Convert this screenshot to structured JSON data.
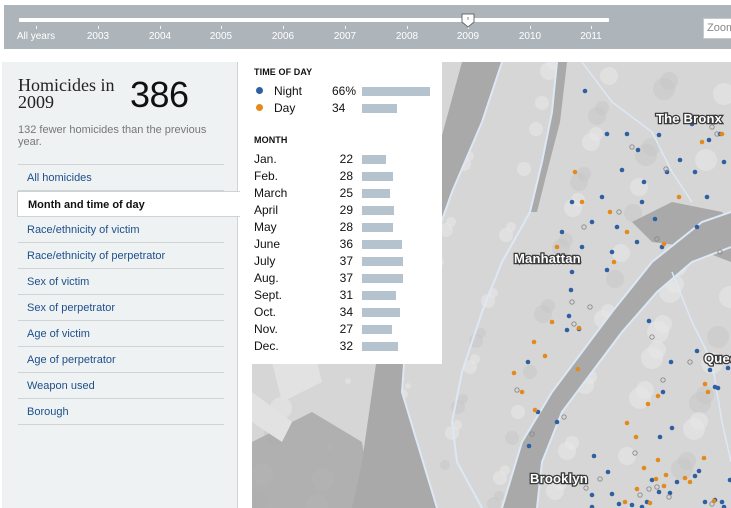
{
  "timeline": {
    "years": [
      "All years",
      "2003",
      "2004",
      "2005",
      "2006",
      "2007",
      "2008",
      "2009",
      "2010",
      "2011"
    ],
    "selected_year": "2009",
    "handle_icon": "slider-handle-icon",
    "zoom_label": "Zoom"
  },
  "sidebar": {
    "headline": "Homicides in 2009",
    "total": "386",
    "subtext": "132 fewer homicides than the previous year.",
    "nav": [
      {
        "label": "All homicides",
        "active": false
      },
      {
        "label": "Month and time of day",
        "active": true
      },
      {
        "label": "Race/ethnicity of victim",
        "active": false
      },
      {
        "label": "Race/ethnicity of perpetrator",
        "active": false
      },
      {
        "label": "Sex of victim",
        "active": false
      },
      {
        "label": "Sex of perpetrator",
        "active": false
      },
      {
        "label": "Age of victim",
        "active": false
      },
      {
        "label": "Age of perpetrator",
        "active": false
      },
      {
        "label": "Weapon used",
        "active": false
      },
      {
        "label": "Borough",
        "active": false
      }
    ]
  },
  "legend": {
    "time_of_day_title": "TIME OF DAY",
    "time_of_day": [
      {
        "label": "Night",
        "value": "66%",
        "pct": 66,
        "color": "#2e5fa3",
        "icon": "dot-icon"
      },
      {
        "label": "Day",
        "value": "34",
        "pct": 34,
        "color": "#e38a1c",
        "icon": "dot-icon"
      }
    ],
    "month_title": "MONTH",
    "months": [
      {
        "label": "Jan.",
        "value": 22
      },
      {
        "label": "Feb.",
        "value": 28
      },
      {
        "label": "March",
        "value": 25
      },
      {
        "label": "April",
        "value": 29
      },
      {
        "label": "May",
        "value": 28
      },
      {
        "label": "June",
        "value": 36
      },
      {
        "label": "July",
        "value": 37
      },
      {
        "label": "Aug.",
        "value": 37
      },
      {
        "label": "Sept.",
        "value": 31
      },
      {
        "label": "Oct.",
        "value": 34
      },
      {
        "label": "Nov.",
        "value": 27
      },
      {
        "label": "Dec.",
        "value": 32
      }
    ],
    "bar_color": "#b4c3ce"
  },
  "map": {
    "labels": [
      "The Bronx",
      "Manhattan",
      "Queens",
      "Brooklyn"
    ],
    "colors": {
      "night": "#2e5fa3",
      "day": "#e38a1c",
      "unknown": "#8a8a8a",
      "land": "#dcdcdc",
      "water": "#a9a9a9",
      "border": "#dce8f5"
    },
    "marker_types": [
      "night",
      "day",
      "unknown"
    ]
  }
}
